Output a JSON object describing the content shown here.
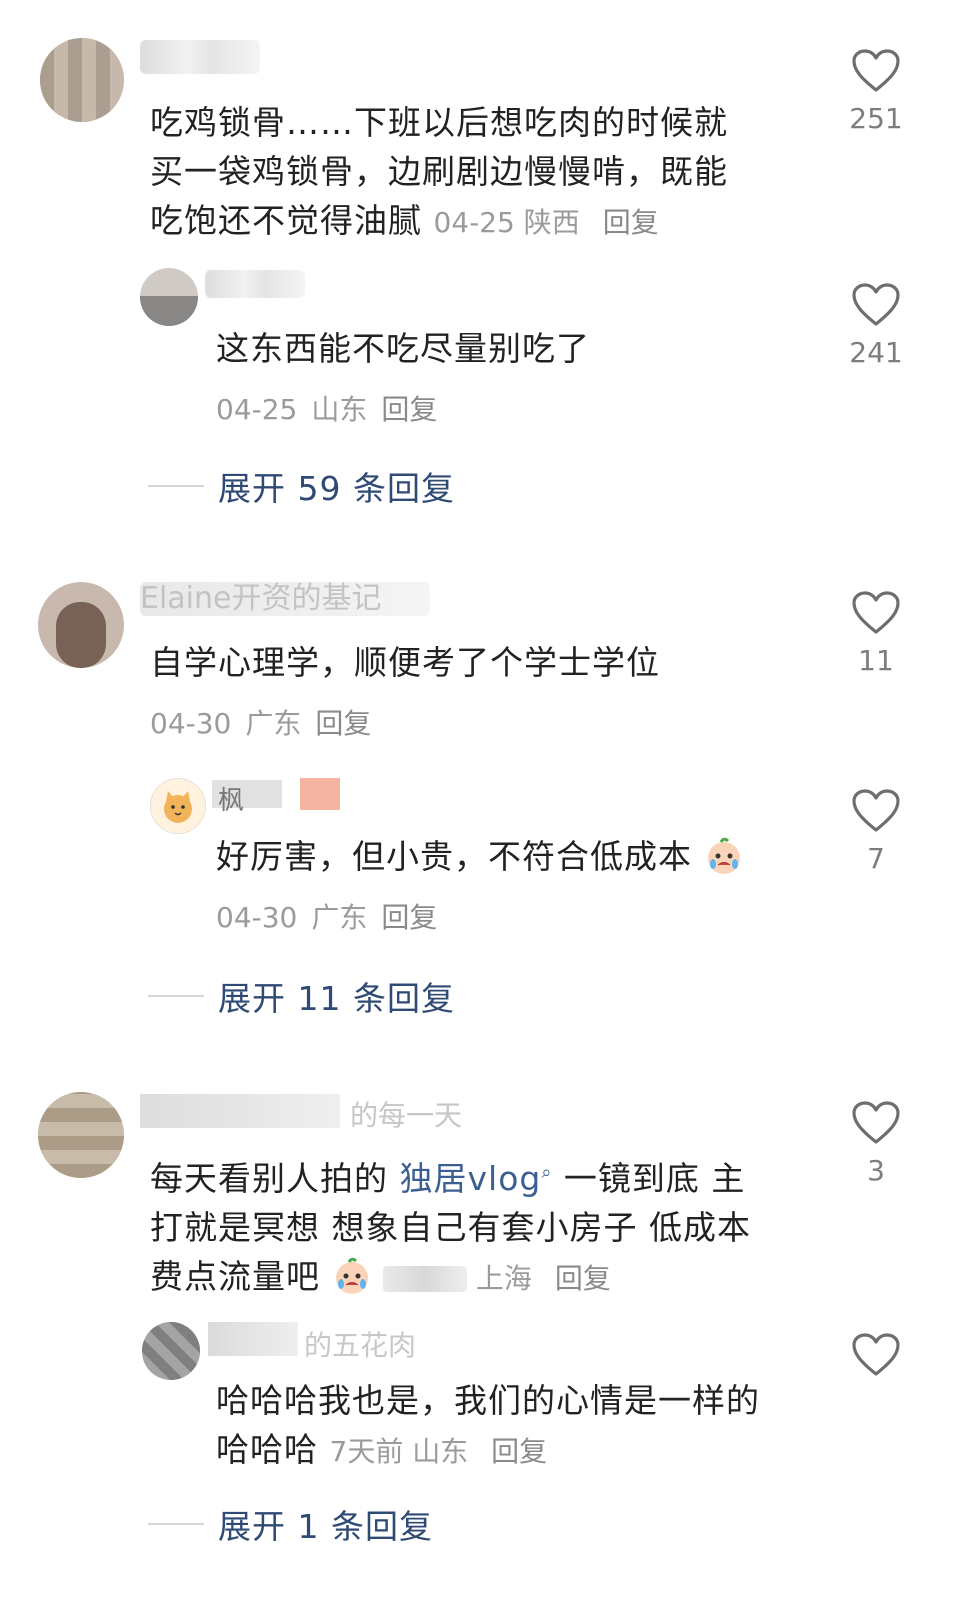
{
  "comments": [
    {
      "text": "吃鸡锁骨……下班以后想吃肉的时候就买一袋鸡锁骨，边刷剧边慢慢啃，既能吃饱还不觉得油腻",
      "line1": "吃鸡锁骨……下班以后想吃肉的时候就",
      "line2": "买一袋鸡锁骨，边刷剧边慢慢啃，既能",
      "line3": "吃饱还不觉得油腻",
      "date": "04-25",
      "location": "陕西",
      "reply": "回复",
      "likes": "251",
      "replies": [
        {
          "text": "这东西能不吃尽量别吃了",
          "date": "04-25",
          "location": "山东",
          "reply": "回复",
          "likes": "241"
        }
      ],
      "expand": "展开 59 条回复"
    },
    {
      "partial_name": "Elaine开资的基记",
      "text": "自学心理学，顺便考了个学士学位",
      "date": "04-30",
      "location": "广东",
      "reply": "回复",
      "likes": "11",
      "replies": [
        {
          "partial_name": "枫",
          "text": "好厉害，但小贵，不符合低成本",
          "date": "04-30",
          "location": "广东",
          "reply": "回复",
          "likes": "7"
        }
      ],
      "expand": "展开 11 条回复"
    },
    {
      "partial_name": "的每一天",
      "line1_pre": "每天看别人拍的 ",
      "line1_link": "独居vlog",
      "line1_post": " 一镜到底 主",
      "line2": "打就是冥想 想象自己有套小房子 低成本",
      "line3": "费点流量吧",
      "location": "上海",
      "reply": "回复",
      "likes": "3",
      "replies": [
        {
          "partial_name": "的五花肉",
          "line1": "哈哈哈我也是，我们的心情是一样的",
          "line2": "哈哈哈",
          "date": "7天前",
          "location": "山东",
          "reply": "回复",
          "likes": ""
        }
      ],
      "expand": "展开 1 条回复"
    }
  ],
  "colors": {
    "text": "#222222",
    "meta": "#9b9b9b",
    "expand": "#2f4a74",
    "link": "#3c5f93"
  },
  "icons": {
    "like": "heart-outline-icon",
    "search_hint": "search-icon",
    "emoji": "crying-emoji-icon"
  }
}
